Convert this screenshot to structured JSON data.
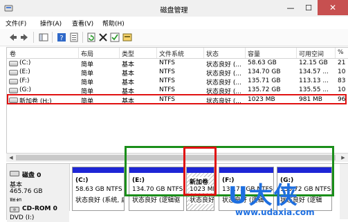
{
  "window": {
    "title": "磁盘管理",
    "minimize": "—",
    "maximize": "☐",
    "close": "✕"
  },
  "menu": [
    "文件(F)",
    "操作(A)",
    "查看(V)",
    "帮助(H)"
  ],
  "columns": [
    "卷",
    "布局",
    "类型",
    "文件系统",
    "状态",
    "容量",
    "可用空间",
    "%"
  ],
  "volumes": [
    {
      "name": "(C:)",
      "layout": "简单",
      "type": "基本",
      "fs": "NTFS",
      "status": "状态良好 (...",
      "capacity": "58.63 GB",
      "free": "12.15 GB",
      "pct": "21"
    },
    {
      "name": "(E:)",
      "layout": "简单",
      "type": "基本",
      "fs": "NTFS",
      "status": "状态良好 (...",
      "capacity": "134.70 GB",
      "free": "134.57 ...",
      "pct": "10"
    },
    {
      "name": "(F:)",
      "layout": "简单",
      "type": "基本",
      "fs": "NTFS",
      "status": "状态良好 (...",
      "capacity": "135.71 GB",
      "free": "113.13 ...",
      "pct": "83"
    },
    {
      "name": "(G:)",
      "layout": "简单",
      "type": "基本",
      "fs": "NTFS",
      "status": "状态良好 (...",
      "capacity": "135.72 GB",
      "free": "135.55 ...",
      "pct": "10"
    },
    {
      "name": "新加卷 (H:)",
      "layout": "简单",
      "type": "基本",
      "fs": "NTFS",
      "status": "状态良好 (...",
      "capacity": "1023 MB",
      "free": "981 MB",
      "pct": "96"
    }
  ],
  "disk0": {
    "name": "磁盘 0",
    "kind": "基本",
    "size": "465.76 GB",
    "state": "联机"
  },
  "partitions": [
    {
      "title": "(C:)",
      "line1": "58.63 GB NTFS",
      "line2": "状态良好 (系统, 启"
    },
    {
      "title": "(E:)",
      "line1": "134.70 GB NTFS",
      "line2": "状态良好 (逻辑驱"
    },
    {
      "title": "新加卷",
      "line1": "1023 MB",
      "line2": "状态良好"
    },
    {
      "title": "(F:)",
      "line1": "135.71 GB NTFS",
      "line2": "状态良好 (逻辑"
    },
    {
      "title": "(G:)",
      "line1": "135.72 GB NTFS",
      "line2": "状态良好 (逻辑"
    }
  ],
  "cdrom": {
    "name": "CD-ROM 0",
    "drive": "DVD (I:)"
  },
  "watermark": {
    "big": "U大侠",
    "url": "www.udaxia.com"
  },
  "colors": {
    "stripe": "#1e26d6",
    "selection_red": "#e01010",
    "group_green": "#1a8e1a",
    "watermark_blue": "#1e6fe0"
  }
}
